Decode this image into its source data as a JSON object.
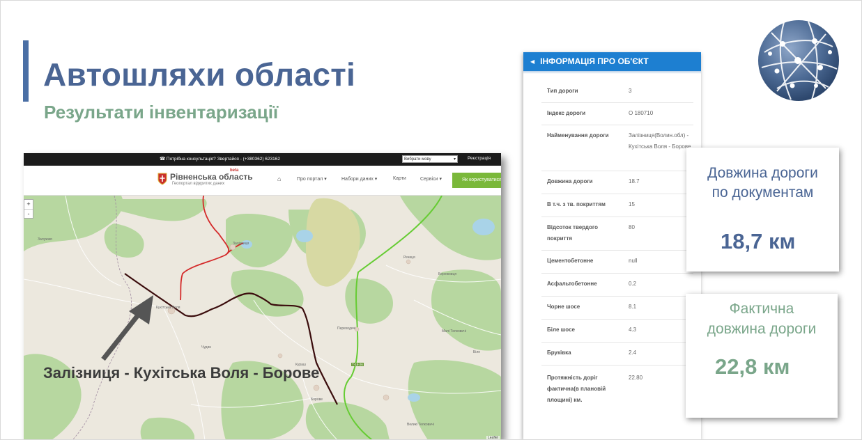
{
  "slide": {
    "title": "Автошляхи області",
    "subtitle": "Результати інвентаризації",
    "road_caption": "Залізниця - Кухітська Воля - Борове"
  },
  "website": {
    "topbar": {
      "consult_text": "☎ Потрібна консультація? Звертайся - (+380362) 623162",
      "language_select": "Вибрати мову",
      "register_link": "Реєстрація"
    },
    "logo_title": "Рівненська область",
    "logo_beta": "beta",
    "logo_subtitle": "Геопортал відкритих даних",
    "nav": {
      "about": "Про портал ▾",
      "datasets": "Набори даних ▾",
      "maps": "Карти",
      "services": "Сервіси ▾",
      "how_to_use": "Як користуватися"
    },
    "map": {
      "zoom_in": "+",
      "zoom_out": "-",
      "labels": {
        "kukhitska_volia": "Кухітська Воля",
        "zalizn": "Залізниця",
        "rechyce": "Речиця",
        "borove": "Борове",
        "bile": "Біле",
        "velyki_telkovychi": "Великі Телковичі",
        "mali_telkovychi": "Малі Телковичі",
        "chudyn": "Чудин",
        "perekhodychi": "Переходичі",
        "berezhnytsia": "Бережниця",
        "kurash": "Кураш",
        "zaluzhzhia": "Залужжя"
      },
      "road_number": "Т-18-26",
      "attribution": "Leaflet"
    }
  },
  "info_panel": {
    "header": "ІНФОРМАЦІЯ ПРО ОБ'ЄКТ",
    "rows": [
      {
        "label": "Тип дороги",
        "value": "3"
      },
      {
        "label": "Індекс дороги",
        "value": "О 180710"
      },
      {
        "label": "Найменування дороги",
        "value": "Залізниця(Волин.обл) - Кухітська Воля - Борове"
      },
      {
        "label": "Довжина дороги",
        "value": "18.7"
      },
      {
        "label": "В т.ч. з тв. покриттям",
        "value": "15"
      },
      {
        "label": "Відсоток твердого покриття",
        "value": "80"
      },
      {
        "label": "Цементобетонне",
        "value": "null"
      },
      {
        "label": "Асфальтобетонне",
        "value": "0.2"
      },
      {
        "label": "Чорне шосе",
        "value": "8.1"
      },
      {
        "label": "Біле шосе",
        "value": "4.3"
      },
      {
        "label": "Бруківка",
        "value": "2.4"
      },
      {
        "label": "Протяжність доріг фактична(в плановій площині) км.",
        "value": "22.80"
      }
    ]
  },
  "callouts": {
    "documented": {
      "text_line1": "Довжина дороги",
      "text_line2": "по документам",
      "value": "18,7 км",
      "color": "#4a6594"
    },
    "actual": {
      "text_line1": "Фактична",
      "text_line2": "довжина дороги",
      "value": "22,8 км",
      "color": "#7aa68a"
    }
  },
  "colors": {
    "title": "#4a6594",
    "subtitle": "#7aa68a",
    "accent_bar": "#4a6fa5",
    "panel_header": "#1d7fd1",
    "route_highlight": "#3b0d0d",
    "route_red": "#d42a2a",
    "route_green": "#66cc33"
  }
}
